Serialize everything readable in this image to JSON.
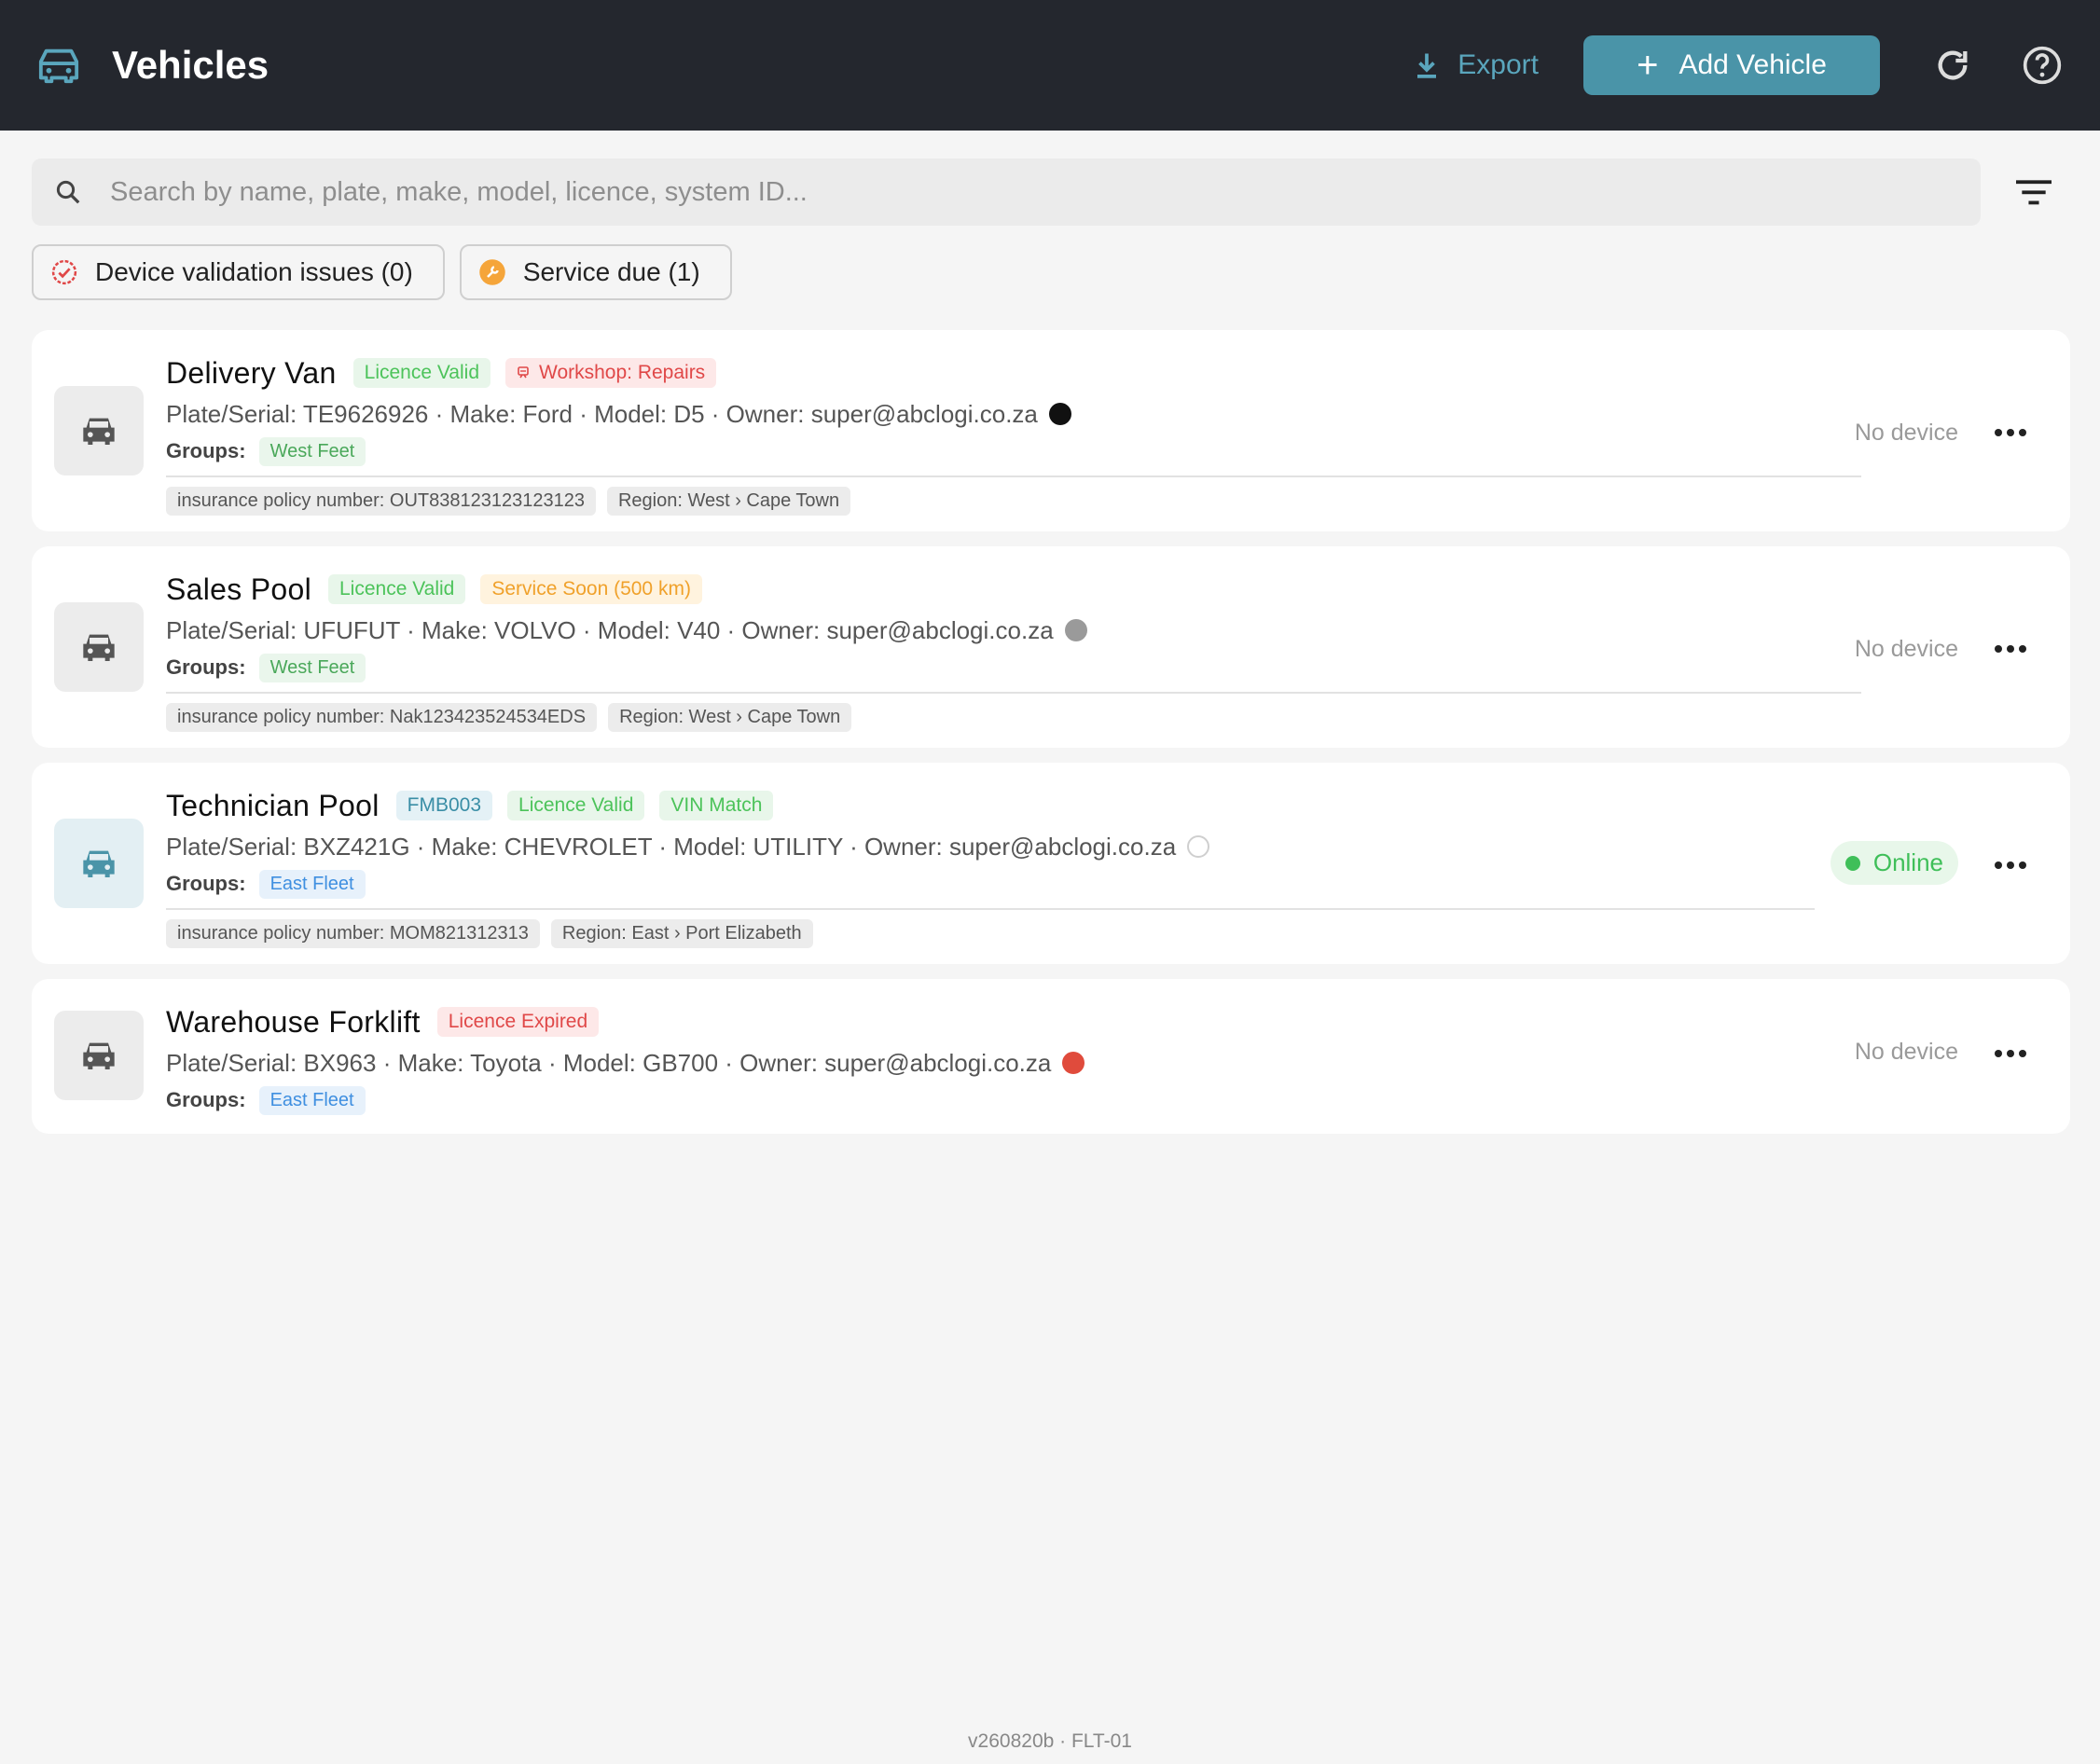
{
  "header": {
    "title": "Vehicles",
    "export_label": "Export",
    "add_label": "Add Vehicle",
    "accent": "#4a94a8"
  },
  "search": {
    "placeholder": "Search by name, plate, make, model, licence, system ID..."
  },
  "chips": [
    {
      "label": "Device validation issues (0)",
      "icon": "alert-badge-icon"
    },
    {
      "label": "Service due (1)",
      "icon": "wrench-circle-icon"
    }
  ],
  "vehicles": [
    {
      "name": "Delivery Van",
      "badges": [
        "Licence Valid",
        "Workshop: Repairs"
      ],
      "details": "Plate/Serial: TE9626926 · Make: Ford · Model: D5 · Owner: super@abclogi.co.za",
      "dot_color": "#111111",
      "groups_label": "Groups:",
      "group": "West Feet",
      "tags": [
        "insurance policy number: OUT838123123123123",
        "Region: West › Cape Town"
      ],
      "device": "No device"
    },
    {
      "name": "Sales Pool",
      "badges": [
        "Licence Valid",
        "Service Soon (500 km)"
      ],
      "details": "Plate/Serial: UFUFUT · Make: VOLVO · Model: V40 · Owner: super@abclogi.co.za",
      "dot_color": "#9a9a9a",
      "groups_label": "Groups:",
      "group": "West Feet",
      "tags": [
        "insurance policy number: Nak123423524534EDS",
        "Region: West › Cape Town"
      ],
      "device": "No device"
    },
    {
      "name": "Technician Pool",
      "badges": [
        "FMB003",
        "Licence Valid",
        "VIN Match"
      ],
      "details": "Plate/Serial: BXZ421G · Make: CHEVROLET · Model: UTILITY · Owner: super@abclogi.co.za",
      "dot_color": "#ffffff",
      "groups_label": "Groups:",
      "group": "East Fleet",
      "tags": [
        "insurance policy number: MOM821312313",
        "Region: East › Port Elizabeth"
      ],
      "device": "Online"
    },
    {
      "name": "Warehouse Forklift",
      "badges": [
        "Licence Expired"
      ],
      "details": "Plate/Serial: BX963 · Make: Toyota · Model: GB700 · Owner: super@abclogi.co.za",
      "dot_color": "#e04b3c",
      "groups_label": "Groups:",
      "group": "East Fleet",
      "device": "No device"
    }
  ],
  "footer": "v260820b · FLT-01"
}
